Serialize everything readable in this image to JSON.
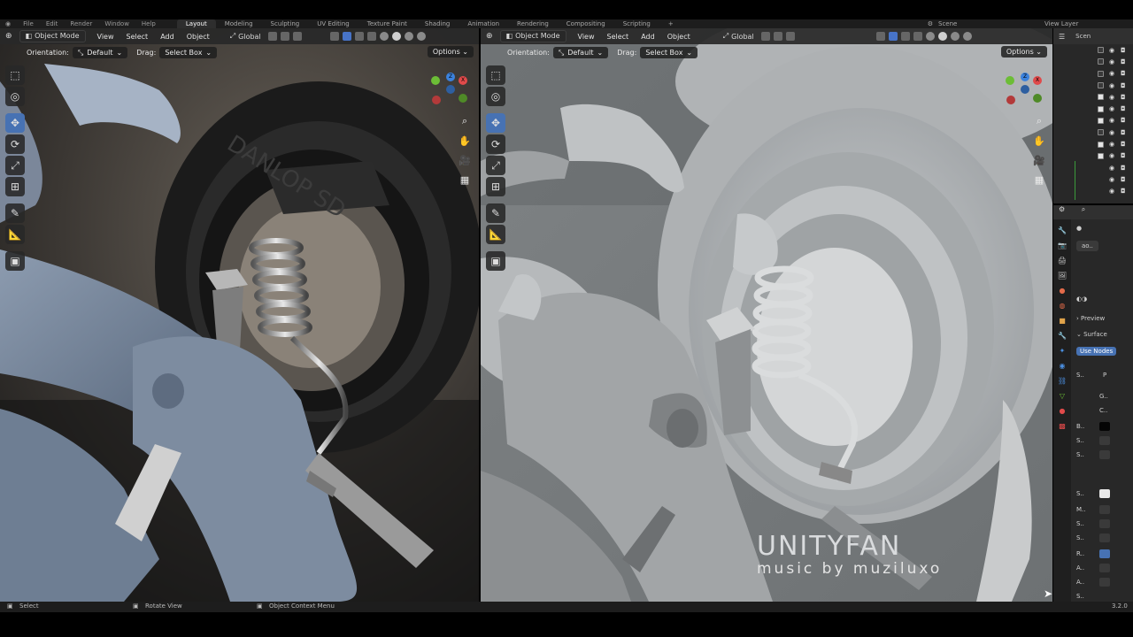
{
  "topbar": {
    "menus": [
      "File",
      "Edit",
      "Render",
      "Window",
      "Help"
    ],
    "workspaces": [
      "Layout",
      "Modeling",
      "Sculpting",
      "UV Editing",
      "Texture Paint",
      "Shading",
      "Animation",
      "Rendering",
      "Compositing",
      "Scripting"
    ],
    "active_workspace": "Layout",
    "scene": "Scene",
    "view_layer": "View Layer"
  },
  "viewport_left": {
    "mode": "Object Mode",
    "menus": [
      "View",
      "Select",
      "Add",
      "Object"
    ],
    "transform": "Global",
    "orientation_label": "Orientation:",
    "orientation_value": "Default",
    "drag_label": "Drag:",
    "drag_value": "Select Box",
    "options": "Options",
    "tire_text": "DANLOP SD"
  },
  "viewport_right": {
    "mode": "Object Mode",
    "menus": [
      "View",
      "Select",
      "Add",
      "Object"
    ],
    "transform": "Global",
    "orientation_label": "Orientation:",
    "orientation_value": "Default",
    "drag_label": "Drag:",
    "drag_value": "Select Box",
    "options": "Options"
  },
  "outliner": {
    "title": "Scen",
    "rows": [
      {
        "name": "",
        "checked": false
      },
      {
        "name": "",
        "checked": false
      },
      {
        "name": "",
        "checked": false
      },
      {
        "name": "",
        "checked": false
      },
      {
        "name": "",
        "checked": true
      },
      {
        "name": "",
        "checked": true
      },
      {
        "name": "",
        "checked": true
      },
      {
        "name": "",
        "checked": false
      },
      {
        "name": "",
        "checked": true
      },
      {
        "name": "",
        "checked": true
      },
      {
        "name": "",
        "checked": false
      },
      {
        "name": "",
        "checked": false
      },
      {
        "name": "",
        "checked": false
      }
    ]
  },
  "properties": {
    "material_slot": "ao..",
    "preview": "Preview",
    "surface": "Surface",
    "use_nodes": "Use Nodes",
    "fields": [
      "S..",
      "G..",
      "C..",
      "B..",
      "S..",
      "S..",
      "S..",
      "M..",
      "S..",
      "S..",
      "R..",
      "A..",
      "A..",
      "S.."
    ],
    "field_p": "P",
    "version": "3.2.0"
  },
  "statusbar": {
    "select": "Select",
    "rotate": "Rotate View",
    "context": "Object Context Menu"
  },
  "watermark": {
    "title": "UNITYFAN",
    "subtitle": "music by muziluxo"
  },
  "colors": {
    "accent": "#4772b3",
    "axis_x": "#e04a4a",
    "axis_y": "#6cbd36",
    "axis_z": "#3b82dd"
  }
}
